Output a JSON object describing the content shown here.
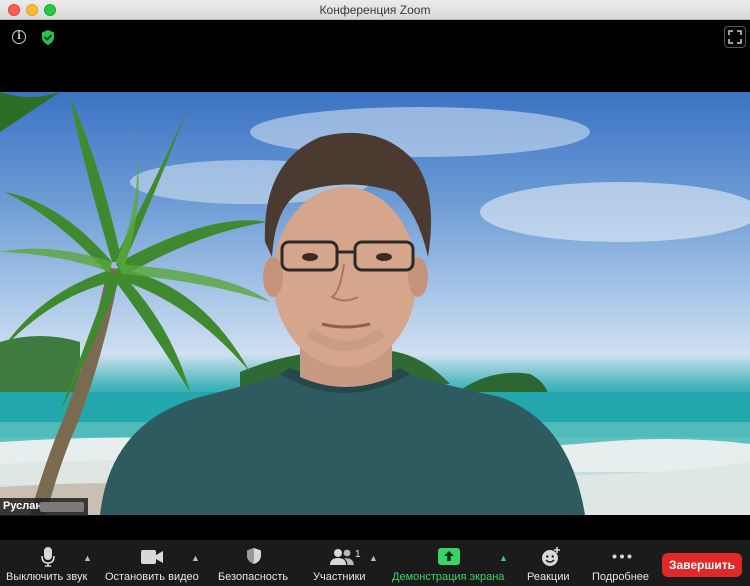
{
  "window": {
    "title": "Конференция Zoom"
  },
  "participant": {
    "name": "Руслан"
  },
  "toolbar": {
    "mute_label": "Выключить звук",
    "video_label": "Остановить видео",
    "security_label": "Безопасность",
    "participants_label": "Участники",
    "participants_count": "1",
    "share_label": "Демонстрация экрана",
    "reactions_label": "Реакции",
    "more_label": "Подробнее",
    "end_label": "Завершить"
  },
  "colors": {
    "end_button": "#e02828",
    "share_accent": "#38d46a",
    "shield": "#23c552"
  }
}
